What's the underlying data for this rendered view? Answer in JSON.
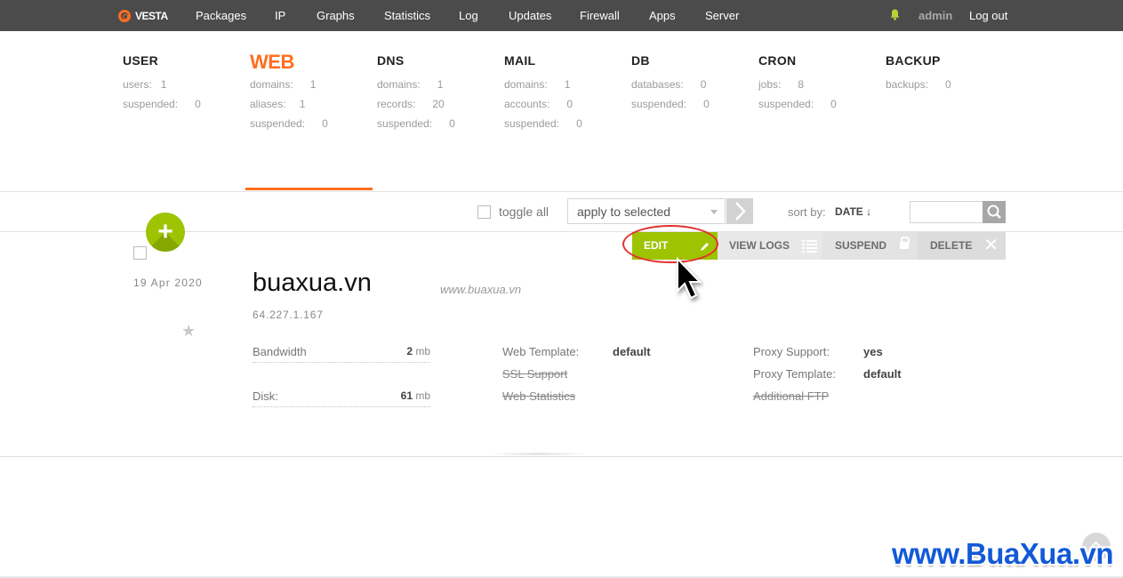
{
  "header": {
    "logo": "VESTA",
    "nav": [
      "Packages",
      "IP",
      "Graphs",
      "Statistics",
      "Log",
      "Updates",
      "Firewall",
      "Apps",
      "Server"
    ],
    "user": "admin",
    "logout": "Log out"
  },
  "stats": [
    {
      "title": "USER",
      "rows": [
        [
          "users:",
          "1"
        ],
        [
          "suspended:",
          "0"
        ]
      ]
    },
    {
      "title": "WEB",
      "active": true,
      "rows": [
        [
          "domains:",
          "1"
        ],
        [
          "aliases:",
          "1"
        ],
        [
          "suspended:",
          "0"
        ]
      ]
    },
    {
      "title": "DNS",
      "rows": [
        [
          "domains:",
          "1"
        ],
        [
          "records:",
          "20"
        ],
        [
          "suspended:",
          "0"
        ]
      ]
    },
    {
      "title": "MAIL",
      "rows": [
        [
          "domains:",
          "1"
        ],
        [
          "accounts:",
          "0"
        ],
        [
          "suspended:",
          "0"
        ]
      ]
    },
    {
      "title": "DB",
      "rows": [
        [
          "databases:",
          "0"
        ],
        [
          "suspended:",
          "0"
        ]
      ]
    },
    {
      "title": "CRON",
      "rows": [
        [
          "jobs:",
          "8"
        ],
        [
          "suspended:",
          "0"
        ]
      ]
    },
    {
      "title": "BACKUP",
      "rows": [
        [
          "backups:",
          "0"
        ]
      ]
    }
  ],
  "toolbar": {
    "toggle_all": "toggle all",
    "apply_select": "apply to selected",
    "sort_label": "sort by:",
    "sort_value": "DATE ↓",
    "add_label": "+"
  },
  "actions": {
    "edit": "EDIT",
    "view_logs": "VIEW LOGS",
    "suspend": "SUSPEND",
    "delete": "DELETE"
  },
  "domain_row": {
    "date": "19 Apr 2020",
    "name": "buaxua.vn",
    "alias": "www.buaxua.vn",
    "ip": "64.227.1.167",
    "bandwidth": {
      "label": "Bandwidth",
      "value": "2",
      "unit": "mb"
    },
    "disk": {
      "label": "Disk:",
      "value": "61",
      "unit": "mb"
    },
    "web_template": {
      "label": "Web Template:",
      "value": "default"
    },
    "ssl_support": "SSL Support",
    "web_statistics": "Web Statistics",
    "proxy_support": {
      "label": "Proxy Support:",
      "value": "yes"
    },
    "proxy_template": {
      "label": "Proxy Template:",
      "value": "default"
    },
    "additional_ftp": "Additional FTP"
  },
  "watermark": "www.BuaXua.vn",
  "colors": {
    "accent": "#ff6e1f",
    "green": "#9ec300",
    "topbar": "#4b4b4b"
  }
}
